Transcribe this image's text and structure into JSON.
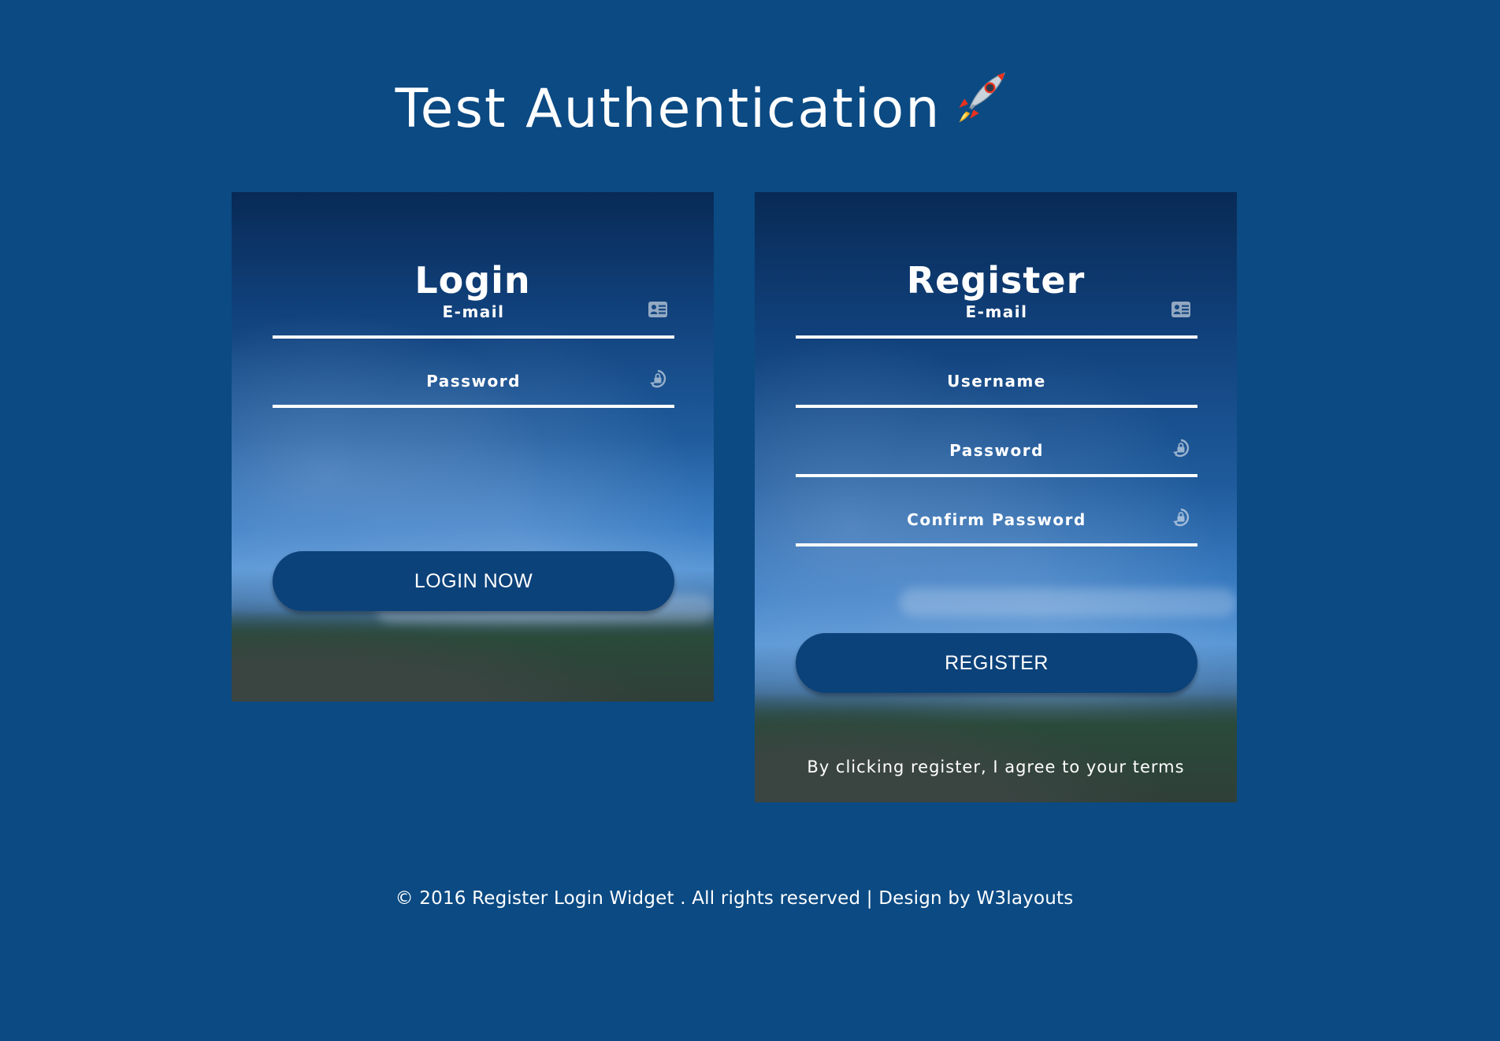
{
  "header": {
    "title": "Test Authentication",
    "title_icon": "rocket-emoji"
  },
  "login": {
    "title": "Login",
    "fields": [
      {
        "placeholder": "E-mail",
        "value": "",
        "icon": "id-card-icon"
      },
      {
        "placeholder": "Password",
        "value": "",
        "icon": "lock-rotate-icon"
      }
    ],
    "submit_label": "LOGIN NOW"
  },
  "register": {
    "title": "Register",
    "fields": [
      {
        "placeholder": "E-mail",
        "value": "",
        "icon": "id-card-icon"
      },
      {
        "placeholder": "Username",
        "value": "",
        "icon": ""
      },
      {
        "placeholder": "Password",
        "value": "",
        "icon": "lock-rotate-icon"
      },
      {
        "placeholder": "Confirm Password",
        "value": "",
        "icon": "lock-rotate-icon"
      }
    ],
    "submit_label": "REGISTER",
    "terms_text": "By clicking register, I agree to your terms"
  },
  "footer": {
    "copyright": "© 2016 Register Login Widget . All rights reserved | Design by ",
    "link_label": "W3layouts"
  },
  "colors": {
    "background": "#0b4a83",
    "button": "#0c427a",
    "text": "#ffffff"
  }
}
